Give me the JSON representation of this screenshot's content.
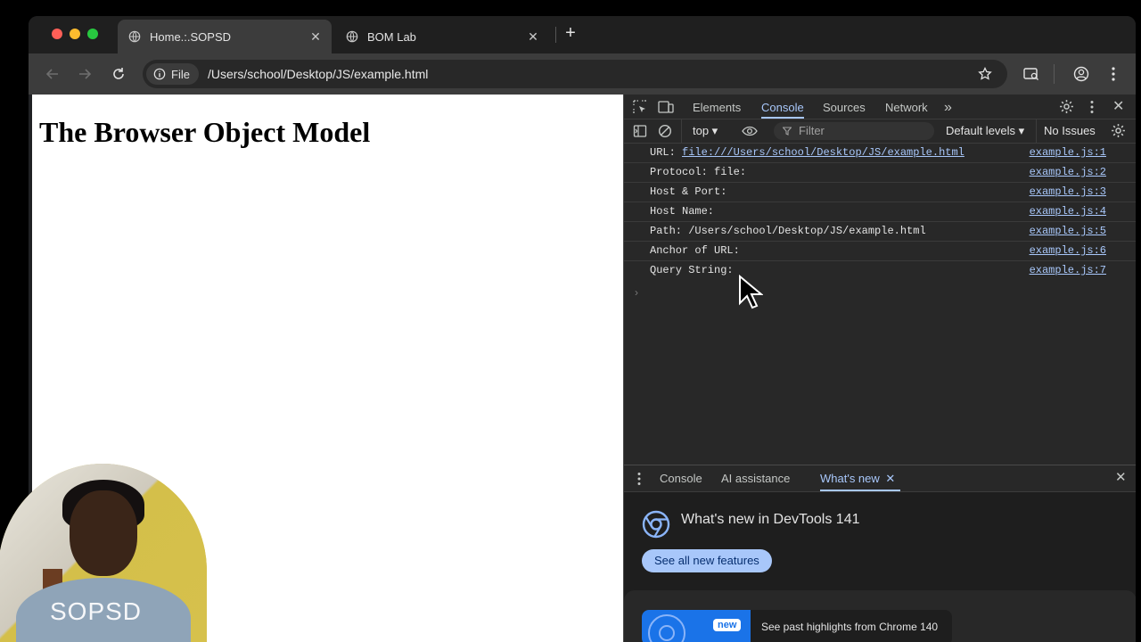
{
  "browser": {
    "tabs": [
      {
        "title": "Home.:.SOPSD",
        "active": true
      },
      {
        "title": "BOM Lab",
        "active": false
      }
    ],
    "new_tab_label": "+",
    "address": {
      "chip_label": "File",
      "url": "/Users/school/Desktop/JS/example.html"
    }
  },
  "page": {
    "heading": "The Browser Object Model"
  },
  "devtools": {
    "tabs": [
      "Elements",
      "Console",
      "Sources",
      "Network"
    ],
    "selected_tab": "Console",
    "more_tabs": "»",
    "context": "top ▾",
    "filter_placeholder": "Filter",
    "levels": "Default levels ▾",
    "issues": "No Issues",
    "console_rows": [
      {
        "label": "URL: ",
        "link": "file:///Users/school/Desktop/JS/example.html",
        "source": "example.js:1"
      },
      {
        "label": "Protocol: file:",
        "link": "",
        "source": "example.js:2"
      },
      {
        "label": "Host & Port:",
        "link": "",
        "source": "example.js:3"
      },
      {
        "label": "Host Name:",
        "link": "",
        "source": "example.js:4"
      },
      {
        "label": "Path: /Users/school/Desktop/JS/example.html",
        "link": "",
        "source": "example.js:5"
      },
      {
        "label": "Anchor of URL:",
        "link": "",
        "source": "example.js:6"
      },
      {
        "label": "Query String:",
        "link": "",
        "source": "example.js:7"
      }
    ],
    "prompt_glyph": "›",
    "drawer": {
      "tabs": [
        "Console",
        "AI assistance",
        "What's new"
      ],
      "selected_tab": "What's new",
      "whats_new_title": "What's new in DevTools 141",
      "see_all_button": "See all new features",
      "card_badge": "new",
      "card_text": "See past highlights from Chrome 140"
    }
  },
  "overlay": {
    "watermark": "SOPSD"
  },
  "colors": {
    "accent": "#a8c7fa",
    "devtools_bg": "#282828",
    "toolbar_bg": "#3c3c3c"
  }
}
